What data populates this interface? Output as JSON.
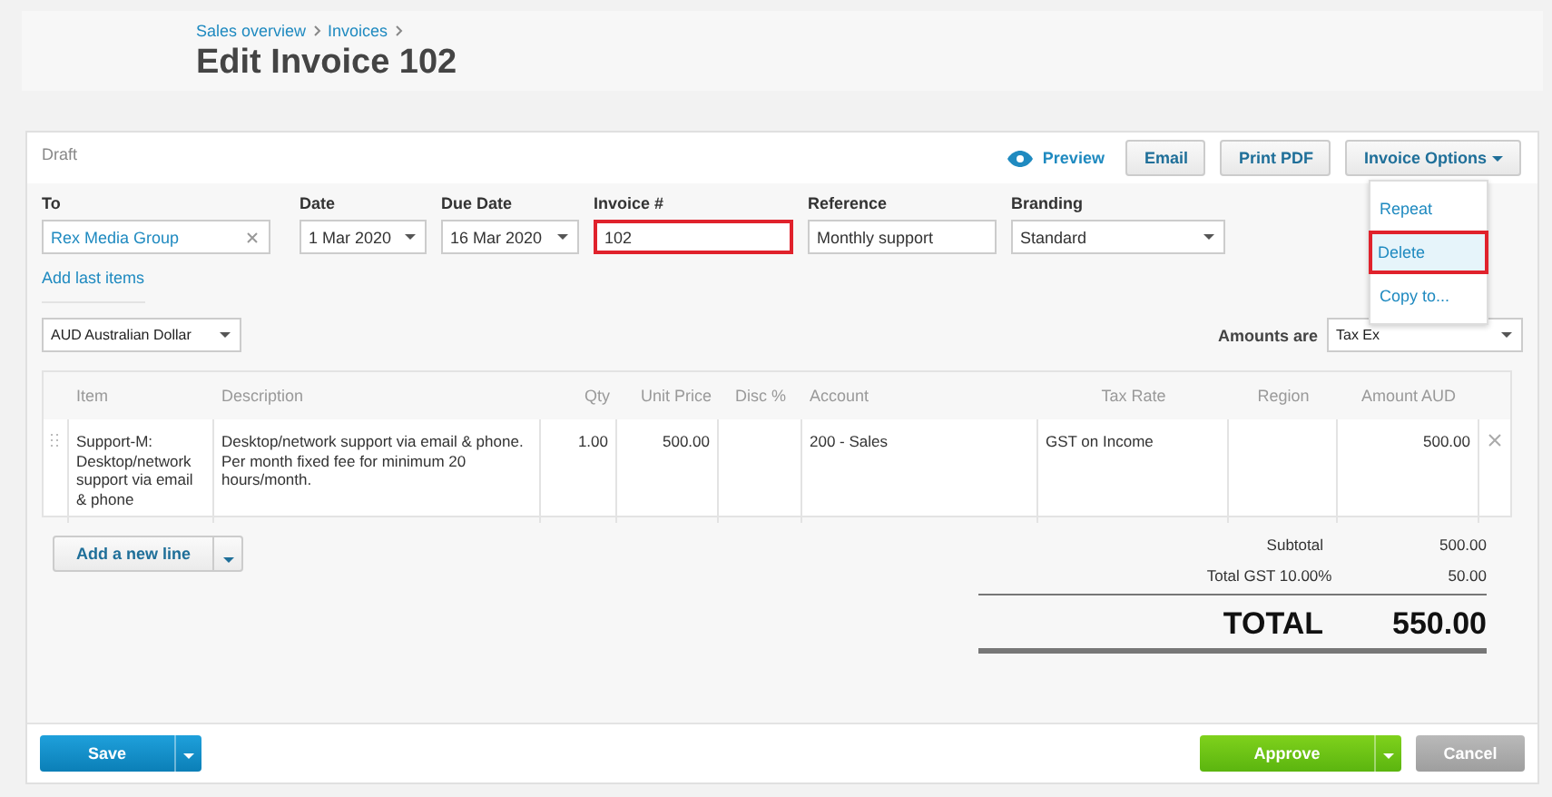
{
  "breadcrumbs": [
    "Sales overview",
    "Invoices"
  ],
  "title": "Edit Invoice 102",
  "status": "Draft",
  "actions": {
    "preview": "Preview",
    "buttons": [
      "Email",
      "Print PDF"
    ],
    "options": "Invoice Options"
  },
  "options_menu": [
    {
      "label": "Repeat",
      "selected": false
    },
    {
      "label": "Delete",
      "selected": true
    },
    {
      "label": "Copy to...",
      "selected": false
    }
  ],
  "fields": [
    {
      "label": "To",
      "value": "Rex Media Group",
      "kind": "contact",
      "highlighted": false
    },
    {
      "label": "Date",
      "value": "1 Mar 2020",
      "kind": "select",
      "highlighted": false
    },
    {
      "label": "Due Date",
      "value": "16 Mar 2020",
      "kind": "select",
      "highlighted": false
    },
    {
      "label": "Invoice #",
      "value": "102",
      "kind": "text",
      "highlighted": true
    },
    {
      "label": "Reference",
      "value": "Monthly support",
      "kind": "text",
      "highlighted": false
    },
    {
      "label": "Branding",
      "value": "Standard",
      "kind": "select",
      "highlighted": false
    }
  ],
  "add_last_items": "Add last items",
  "currency": "AUD Australian Dollar",
  "amounts_are": {
    "label": "Amounts are",
    "value": "Tax Ex"
  },
  "table": {
    "columns": [
      "Item",
      "Description",
      "Qty",
      "Unit Price",
      "Disc %",
      "Account",
      "Tax Rate",
      "Region",
      "Amount AUD"
    ],
    "rows": [
      [
        "Support-M: Desktop/network support via email & phone",
        "Desktop/network support via email & phone. Per month fixed fee for minimum 20 hours/month.",
        "1.00",
        "500.00",
        "",
        "200 - Sales",
        "GST on Income",
        "",
        "500.00"
      ]
    ]
  },
  "add_line": "Add a new line",
  "totals": [
    {
      "label": "Subtotal",
      "value": "500.00"
    },
    {
      "label": "Total GST 10.00%",
      "value": "50.00"
    }
  ],
  "total": {
    "label": "TOTAL",
    "value": "550.00"
  },
  "footer": {
    "save": "Save",
    "approve": "Approve",
    "cancel": "Cancel"
  }
}
